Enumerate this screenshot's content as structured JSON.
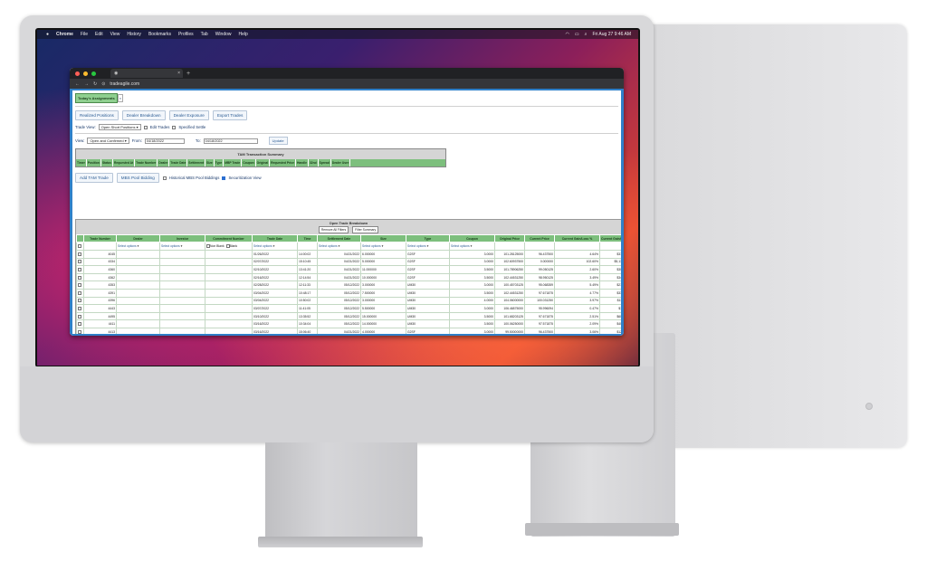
{
  "menubar": {
    "app": "Chrome",
    "items": [
      "File",
      "Edit",
      "View",
      "History",
      "Bookmarks",
      "Profiles",
      "Tab",
      "Window",
      "Help"
    ],
    "clock": "Fri Aug 27 9:46 AM"
  },
  "browser": {
    "tab_title": "",
    "url": "tradeagile.com"
  },
  "app": {
    "assignments_label": "Today's Assignments",
    "nav_buttons": [
      "Realized Positions",
      "Dealer Breakdown",
      "Dealer Exposure",
      "Export Trades"
    ],
    "trade_view_label": "Trade View:",
    "trade_view_value": "Open Short Positions",
    "edit_trades_label": "Edit Trades",
    "specified_settle_label": "Specified Settle",
    "view_label": "View:",
    "view_value": "Open and Confirmed",
    "from_label": "From:",
    "from_value": "04/18/2022",
    "to_label": "To:",
    "to_value": "04/18/2022",
    "update_label": "Update",
    "summary": {
      "title": "TAM Transaction Summary",
      "headers": [
        "Timer",
        "Position",
        "Status",
        "Requested At",
        "Trade Number",
        "Dealer",
        "Trade Date",
        "Settlement",
        "Size",
        "Type",
        "MBP Trade",
        "Coupon",
        "Original",
        "Requested Price",
        "Handle",
        "32nd",
        "Spread",
        "Dealer User"
      ]
    },
    "actions": {
      "add_tam": "Add TAM Trade",
      "mbs_pool": "MBS Pool Bidding",
      "historical": "Historical MBS Pool Biddings",
      "securitization": "Securitization View"
    },
    "grid": {
      "title": "Open Trade Breakdown",
      "remove_filters": "Remove All Filters",
      "filter_summary": "Filter Summary",
      "headers": [
        "",
        "Trade Number",
        "Dealer",
        "Investor",
        "Commitment Number",
        "Trade Date",
        "Time",
        "Settlement Date",
        "Size",
        "Type",
        "Coupon",
        "Original Price",
        "Current Price",
        "Current Gain/Loss %",
        "Current Gain/L"
      ],
      "filter_placeholder": "Select options",
      "non_blank": "Non Blank",
      "blank": "Blank",
      "rows": [
        [
          "4045",
          "",
          "",
          "",
          "01/26/2022",
          "14:00:02",
          "04/21/2022",
          "6.000000",
          "G2SF",
          "3.0000",
          "101.28125000",
          "96.437500",
          "4.64%",
          "$31"
        ],
        [
          "4334",
          "",
          "",
          "",
          "02/07/2022",
          "15:10:45",
          "04/21/2022",
          "5.000000",
          "G2SF",
          "3.0000",
          "102.60937500",
          "0.000000",
          "102.60%",
          "$5,13"
        ],
        [
          "4360",
          "",
          "",
          "",
          "02/10/2022",
          "13:41:20",
          "04/21/2022",
          "11.000000",
          "G2SF",
          "3.5000",
          "101.78906250",
          "99.050125",
          "2.60%",
          "$30"
        ],
        [
          "4362",
          "",
          "",
          "",
          "02/16/2022",
          "12:14:54",
          "04/21/2022",
          "10.000000",
          "G2SF",
          "3.5000",
          "102.44531250",
          "98.950125",
          "3.49%",
          "$34"
        ],
        [
          "4353",
          "",
          "",
          "",
          "02/28/2022",
          "12:11:33",
          "05/12/2022",
          "3.000000",
          "UM30",
          "3.0000",
          "100.45703125",
          "95.068359",
          "5.49%",
          "$21"
        ],
        [
          "4391",
          "",
          "",
          "",
          "03/04/2022",
          "10:48:17",
          "05/12/2022",
          "7.500000",
          "UM30",
          "3.5000",
          "102.44531250",
          "97.671875",
          "4.77%",
          "$33"
        ],
        [
          "4396",
          "",
          "",
          "",
          "03/04/2022",
          "10:50:02",
          "05/12/2022",
          "3.000000",
          "UM30",
          "4.0000",
          "104.06000000",
          "100.031250",
          "3.97%",
          "$11"
        ],
        [
          "4443",
          "",
          "",
          "",
          "03/07/2022",
          "11:41:05",
          "05/12/2022",
          "5.500000",
          "UM30",
          "3.0000",
          "106.46875000",
          "95.996094",
          "0.47%",
          "$1"
        ],
        [
          "4495",
          "",
          "",
          "",
          "03/10/2022",
          "13:35:52",
          "05/12/2022",
          "15.000000",
          "UM30",
          "3.5000",
          "101.68203125",
          "97.671875",
          "2.51%",
          "$60"
        ],
        [
          "4411",
          "",
          "",
          "",
          "03/16/2022",
          "10:34:04",
          "05/12/2022",
          "14.000000",
          "UM30",
          "3.5000",
          "100.06250000",
          "97.571875",
          "2.09%",
          "$40"
        ],
        [
          "4413",
          "",
          "",
          "",
          "03/16/2022",
          "15:06:40",
          "04/21/2022",
          "4.000000",
          "G2SF",
          "3.0000",
          "99.50000000",
          "96.437500",
          "3.06%",
          "$12"
        ]
      ]
    }
  }
}
